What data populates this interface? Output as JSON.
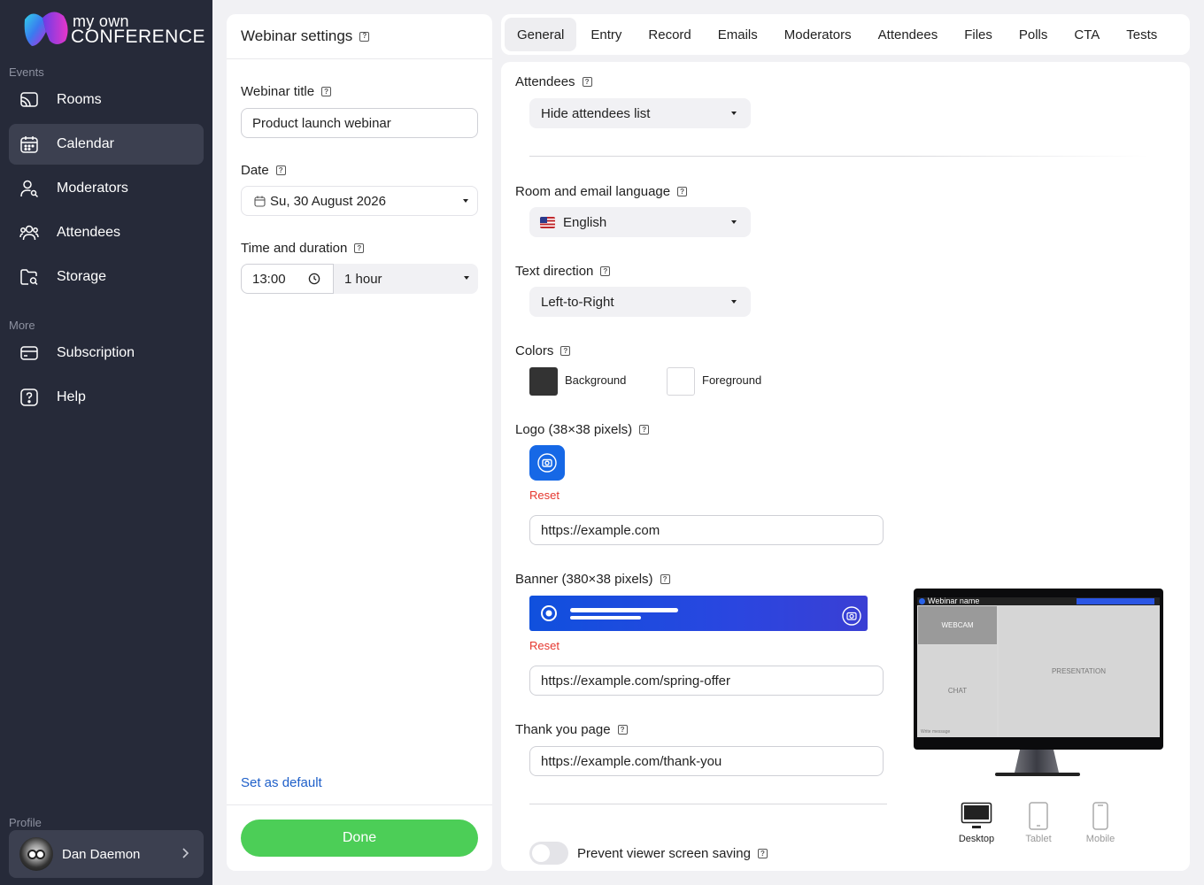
{
  "brand": {
    "line1": "my own",
    "line2": "CONFERENCE"
  },
  "sidebar": {
    "events_heading": "Events",
    "more_heading": "More",
    "profile_heading": "Profile",
    "items": [
      {
        "label": "Rooms",
        "icon": "cast-icon"
      },
      {
        "label": "Calendar",
        "icon": "calendar-icon",
        "active": true
      },
      {
        "label": "Moderators",
        "icon": "user-key-icon"
      },
      {
        "label": "Attendees",
        "icon": "users-icon"
      },
      {
        "label": "Storage",
        "icon": "folder-search-icon"
      },
      {
        "label": "Subscription",
        "icon": "credit-card-icon"
      },
      {
        "label": "Help",
        "icon": "help-icon"
      }
    ],
    "profile": {
      "name": "Dan Daemon"
    }
  },
  "webinar_panel": {
    "title": "Webinar settings",
    "title_label": "Webinar title",
    "title_value": "Product launch webinar",
    "date_label": "Date",
    "date_value": "Su, 30 August 2026",
    "time_label": "Time and duration",
    "time_value": "13:00",
    "duration_value": "1 hour",
    "set_default": "Set as default",
    "done": "Done"
  },
  "tabs": [
    "General",
    "Entry",
    "Record",
    "Emails",
    "Moderators",
    "Attendees",
    "Files",
    "Polls",
    "CTA",
    "Tests"
  ],
  "active_tab": "General",
  "general": {
    "attendees_label": "Attendees",
    "attendees_value": "Hide attendees list",
    "language_label": "Room and email language",
    "language_value": "English",
    "direction_label": "Text direction",
    "direction_value": "Left-to-Right",
    "colors_label": "Colors",
    "background_label": "Background",
    "background_color": "#333333",
    "foreground_label": "Foreground",
    "foreground_color": "#ffffff",
    "logo_label": "Logo (38×38 pixels)",
    "logo_reset": "Reset",
    "logo_url": "https://example.com",
    "banner_label": "Banner (380×38 pixels)",
    "banner_reset": "Reset",
    "banner_url": "https://example.com/spring-offer",
    "thankyou_label": "Thank you page",
    "thankyou_url": "https://example.com/thank-you",
    "screen_saving_label": "Prevent viewer screen saving",
    "screen_saving_on": false
  },
  "preview": {
    "webinar_name": "Webinar name",
    "webcam": "WEBCAM",
    "chat": "CHAT",
    "presentation": "PRESENTATION",
    "write_message": "Write message",
    "devices": [
      {
        "label": "Desktop",
        "active": true
      },
      {
        "label": "Tablet",
        "active": false
      },
      {
        "label": "Mobile",
        "active": false
      }
    ]
  },
  "colors": {
    "accent_green": "#4cce57",
    "link_blue": "#1e5fc9",
    "reset_red": "#e5362e",
    "sidebar_bg": "#262a39"
  }
}
